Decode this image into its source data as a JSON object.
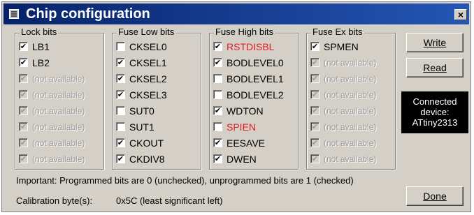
{
  "window": {
    "title": "Chip configuration",
    "close_label": "×"
  },
  "groups": [
    {
      "title": "Lock bits",
      "items": [
        {
          "label": "LB1",
          "checked": true,
          "disabled": false,
          "red": false
        },
        {
          "label": "LB2",
          "checked": true,
          "disabled": false,
          "red": false
        },
        {
          "label": "(not available)",
          "checked": true,
          "disabled": true,
          "red": false
        },
        {
          "label": "(not available)",
          "checked": true,
          "disabled": true,
          "red": false
        },
        {
          "label": "(not available)",
          "checked": true,
          "disabled": true,
          "red": false
        },
        {
          "label": "(not available)",
          "checked": true,
          "disabled": true,
          "red": false
        },
        {
          "label": "(not available)",
          "checked": true,
          "disabled": true,
          "red": false
        },
        {
          "label": "(not available)",
          "checked": true,
          "disabled": true,
          "red": false
        }
      ]
    },
    {
      "title": "Fuse Low bits",
      "items": [
        {
          "label": "CKSEL0",
          "checked": false,
          "disabled": false,
          "red": false
        },
        {
          "label": "CKSEL1",
          "checked": true,
          "disabled": false,
          "red": false
        },
        {
          "label": "CKSEL2",
          "checked": true,
          "disabled": false,
          "red": false
        },
        {
          "label": "CKSEL3",
          "checked": true,
          "disabled": false,
          "red": false
        },
        {
          "label": "SUT0",
          "checked": false,
          "disabled": false,
          "red": false
        },
        {
          "label": "SUT1",
          "checked": false,
          "disabled": false,
          "red": false
        },
        {
          "label": "CKOUT",
          "checked": true,
          "disabled": false,
          "red": false
        },
        {
          "label": "CKDIV8",
          "checked": true,
          "disabled": false,
          "red": false
        }
      ]
    },
    {
      "title": "Fuse High bits",
      "items": [
        {
          "label": "RSTDISBL",
          "checked": true,
          "disabled": false,
          "red": true
        },
        {
          "label": "BODLEVEL0",
          "checked": true,
          "disabled": false,
          "red": false
        },
        {
          "label": "BODLEVEL1",
          "checked": false,
          "disabled": false,
          "red": false
        },
        {
          "label": "BODLEVEL2",
          "checked": false,
          "disabled": false,
          "red": false
        },
        {
          "label": "WDTON",
          "checked": true,
          "disabled": false,
          "red": false
        },
        {
          "label": "SPIEN",
          "checked": false,
          "disabled": false,
          "red": true
        },
        {
          "label": "EESAVE",
          "checked": true,
          "disabled": false,
          "red": false
        },
        {
          "label": "DWEN",
          "checked": true,
          "disabled": false,
          "red": false
        }
      ]
    },
    {
      "title": "Fuse Ex bits",
      "items": [
        {
          "label": "SPMEN",
          "checked": true,
          "disabled": false,
          "red": false
        },
        {
          "label": "(not available)",
          "checked": true,
          "disabled": true,
          "red": false
        },
        {
          "label": "(not available)",
          "checked": true,
          "disabled": true,
          "red": false
        },
        {
          "label": "(not available)",
          "checked": true,
          "disabled": true,
          "red": false
        },
        {
          "label": "(not available)",
          "checked": true,
          "disabled": true,
          "red": false
        },
        {
          "label": "(not available)",
          "checked": true,
          "disabled": true,
          "red": false
        },
        {
          "label": "(not available)",
          "checked": true,
          "disabled": true,
          "red": false
        },
        {
          "label": "(not available)",
          "checked": true,
          "disabled": true,
          "red": false
        }
      ]
    }
  ],
  "buttons": {
    "write": "Write",
    "read": "Read",
    "done": "Done"
  },
  "device": {
    "line1": "Connected",
    "line2": "device:",
    "line3": "ATtiny2313"
  },
  "note": "Important: Programmed bits are 0 (unchecked), unprogrammed bits are 1 (checked)",
  "calibration": {
    "label": "Calibration byte(s):",
    "value": "0x5C (least significant left)"
  },
  "colors": {
    "title_bar_start": "#06236a",
    "title_bar_end": "#2456b5",
    "red_label": "#e31b23",
    "disabled_text": "#9a9a9a",
    "face": "#d4d0c8"
  },
  "icons": {
    "app": "chip-icon",
    "close": "close-icon"
  }
}
